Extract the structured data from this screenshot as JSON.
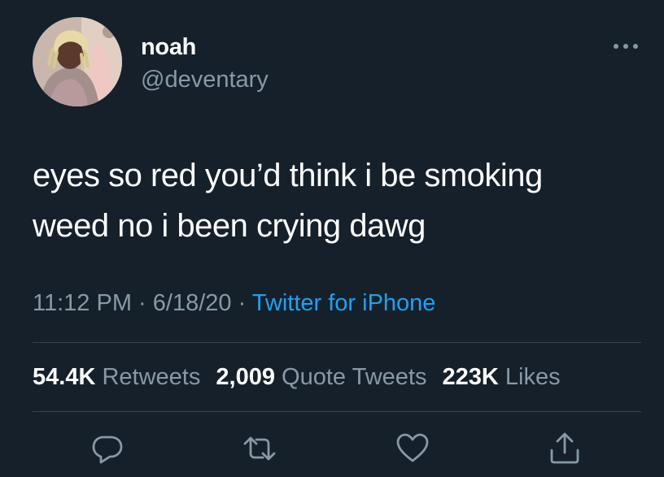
{
  "user": {
    "display_name": "noah",
    "handle": "@deventary"
  },
  "tweet": {
    "text_line1": "eyes so red you’d think i be smoking",
    "text_line2": "weed no i been crying dawg"
  },
  "meta": {
    "time": "11:12 PM",
    "separator": " · ",
    "date": "6/18/20",
    "source": "Twitter for iPhone"
  },
  "stats": {
    "retweets_count": "54.4K",
    "retweets_label": "Retweets",
    "quote_tweets_count": "2,009",
    "quote_tweets_label": "Quote Tweets",
    "likes_count": "223K",
    "likes_label": "Likes"
  },
  "actions": {
    "icons": [
      "reply-icon",
      "retweet-icon",
      "like-icon",
      "share-icon"
    ]
  },
  "colors": {
    "background": "#15202b",
    "primary_text": "#ffffff",
    "secondary_text": "#8899a6",
    "link": "#1da1f2",
    "divider": "#38444d"
  }
}
